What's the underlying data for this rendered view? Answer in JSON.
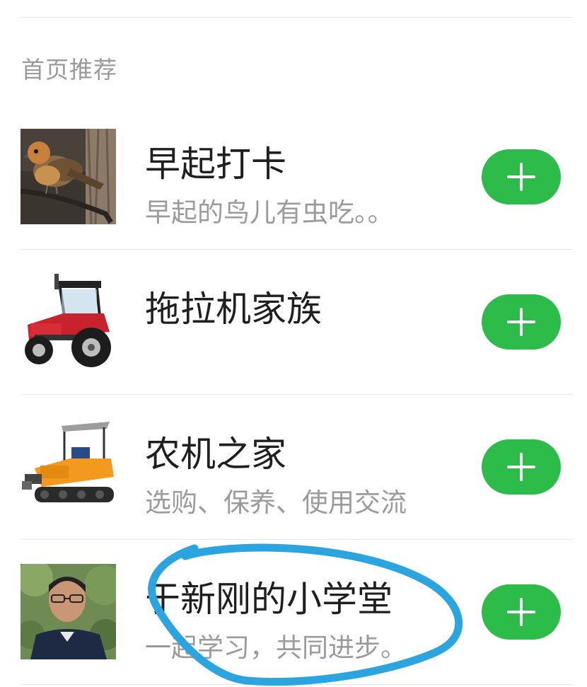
{
  "section": {
    "title": "首页推荐"
  },
  "groups": [
    {
      "title": "早起打卡",
      "subtitle": "早起的鸟儿有虫吃。。",
      "avatar": "bird-avatar-icon"
    },
    {
      "title": "拖拉机家族",
      "subtitle": "",
      "avatar": "tractor-avatar-icon"
    },
    {
      "title": "农机之家",
      "subtitle": "选购、保养、使用交流",
      "avatar": "crawler-machine-avatar-icon"
    },
    {
      "title": "于新刚的小学堂",
      "subtitle": "一起学习，共同进步。",
      "avatar": "person-avatar-icon"
    }
  ],
  "colors": {
    "accent": "#2dbb4a",
    "annotation": "#2aa5e0"
  }
}
